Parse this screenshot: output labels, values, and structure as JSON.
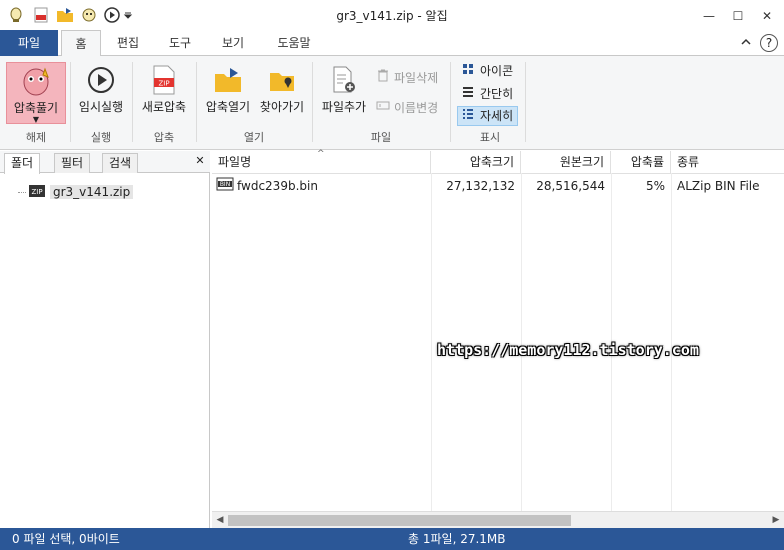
{
  "window": {
    "title": "gr3_v141.zip - 알집",
    "minimize": "—",
    "maximize": "☐",
    "close": "✕"
  },
  "menu": {
    "file_tab": "파일",
    "tabs": [
      "홈",
      "편집",
      "도구",
      "보기",
      "도움말"
    ],
    "help": "?"
  },
  "ribbon": {
    "extract": "압축풀기",
    "temp_run": "임시실행",
    "new_zip": "새로압축",
    "open_zip": "압축열기",
    "find": "찾아가기",
    "add_file": "파일추가",
    "delete_file": "파일삭제",
    "rename": "이름변경",
    "view_icon": "아이콘",
    "view_simple": "간단히",
    "view_detail": "자세히",
    "groups": {
      "extract": "해제",
      "run": "실행",
      "compress": "압축",
      "open": "열기",
      "file": "파일",
      "display": "표시"
    },
    "zip_badge": "ZIP"
  },
  "left_pane": {
    "tabs": [
      "폴더",
      "필터",
      "검색"
    ],
    "tree_item": "gr3_v141.zip",
    "tree_badge": "ZIP"
  },
  "list": {
    "columns": [
      "파일명",
      "압축크기",
      "원본크기",
      "압축률",
      "종류"
    ],
    "rows": [
      {
        "name": "fwdc239b.bin",
        "compressed": "27,132,132",
        "original": "28,516,544",
        "ratio": "5%",
        "type": "ALZip BIN File",
        "badge": "BIN"
      }
    ]
  },
  "watermark": "https://memory112.tistory.com",
  "status": {
    "left": "0 파일 선택,  0바이트",
    "right": "총 1파일,  27.1MB"
  },
  "colors": {
    "accent": "#2b5797",
    "selected_tool": "#f4b5bd",
    "selected_view": "#cce4f7"
  }
}
